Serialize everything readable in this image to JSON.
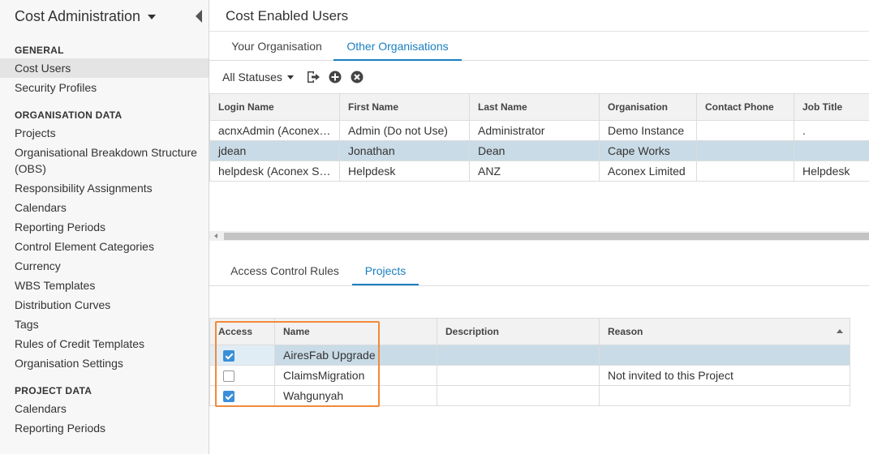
{
  "sidebar": {
    "title": "Cost Administration",
    "sections": {
      "general": "GENERAL",
      "organisation_data": "ORGANISATION DATA",
      "project_data": "PROJECT DATA"
    },
    "general_items": [
      "Cost Users",
      "Security Profiles"
    ],
    "organisation_items": [
      "Projects",
      "Organisational Breakdown Structure (OBS)",
      "Responsibility Assignments",
      "Calendars",
      "Reporting Periods",
      "Control Element Categories",
      "Currency",
      "WBS Templates",
      "Distribution Curves",
      "Tags",
      "Rules of Credit Templates",
      "Organisation Settings"
    ],
    "project_items": [
      "Calendars",
      "Reporting Periods"
    ]
  },
  "main": {
    "title": "Cost Enabled Users",
    "tabs": [
      "Your Organisation",
      "Other Organisations"
    ],
    "active_tab": "Other Organisations",
    "toolbar": {
      "status_filter": "All Statuses",
      "icons": [
        "export-icon",
        "add-icon",
        "remove-icon"
      ]
    },
    "users_grid": {
      "columns": [
        "Login Name",
        "First Name",
        "Last Name",
        "Organisation",
        "Contact Phone",
        "Job Title"
      ],
      "rows": [
        [
          "acnxAdmin (Aconex Admin)",
          "Admin (Do not Use)",
          "Administrator",
          "Demo Instance",
          "",
          "."
        ],
        [
          "jdean",
          "Jonathan",
          "Dean",
          "Cape Works",
          "",
          ""
        ],
        [
          "helpdesk (Aconex Support)",
          "Helpdesk",
          "ANZ",
          "Aconex Limited",
          "",
          "Helpdesk"
        ]
      ],
      "selected_row": 1
    },
    "detail_tabs": [
      "Access Control Rules",
      "Projects"
    ],
    "active_detail_tab": "Projects",
    "projects_grid": {
      "columns": [
        "Access",
        "Name",
        "Description",
        "Reason"
      ],
      "rows": [
        {
          "access": true,
          "name": "AiresFab Upgrade",
          "description": "",
          "reason": ""
        },
        {
          "access": false,
          "name": "ClaimsMigration",
          "description": "",
          "reason": "Not invited to this Project"
        },
        {
          "access": true,
          "name": "Wahgunyah",
          "description": "",
          "reason": ""
        }
      ],
      "selected_row": 0
    }
  },
  "colors": {
    "accent": "#1a7fc1",
    "selected_row": "#c9dbe6",
    "checkbox": "#3b8fd8",
    "highlight": "#f28a3a"
  }
}
